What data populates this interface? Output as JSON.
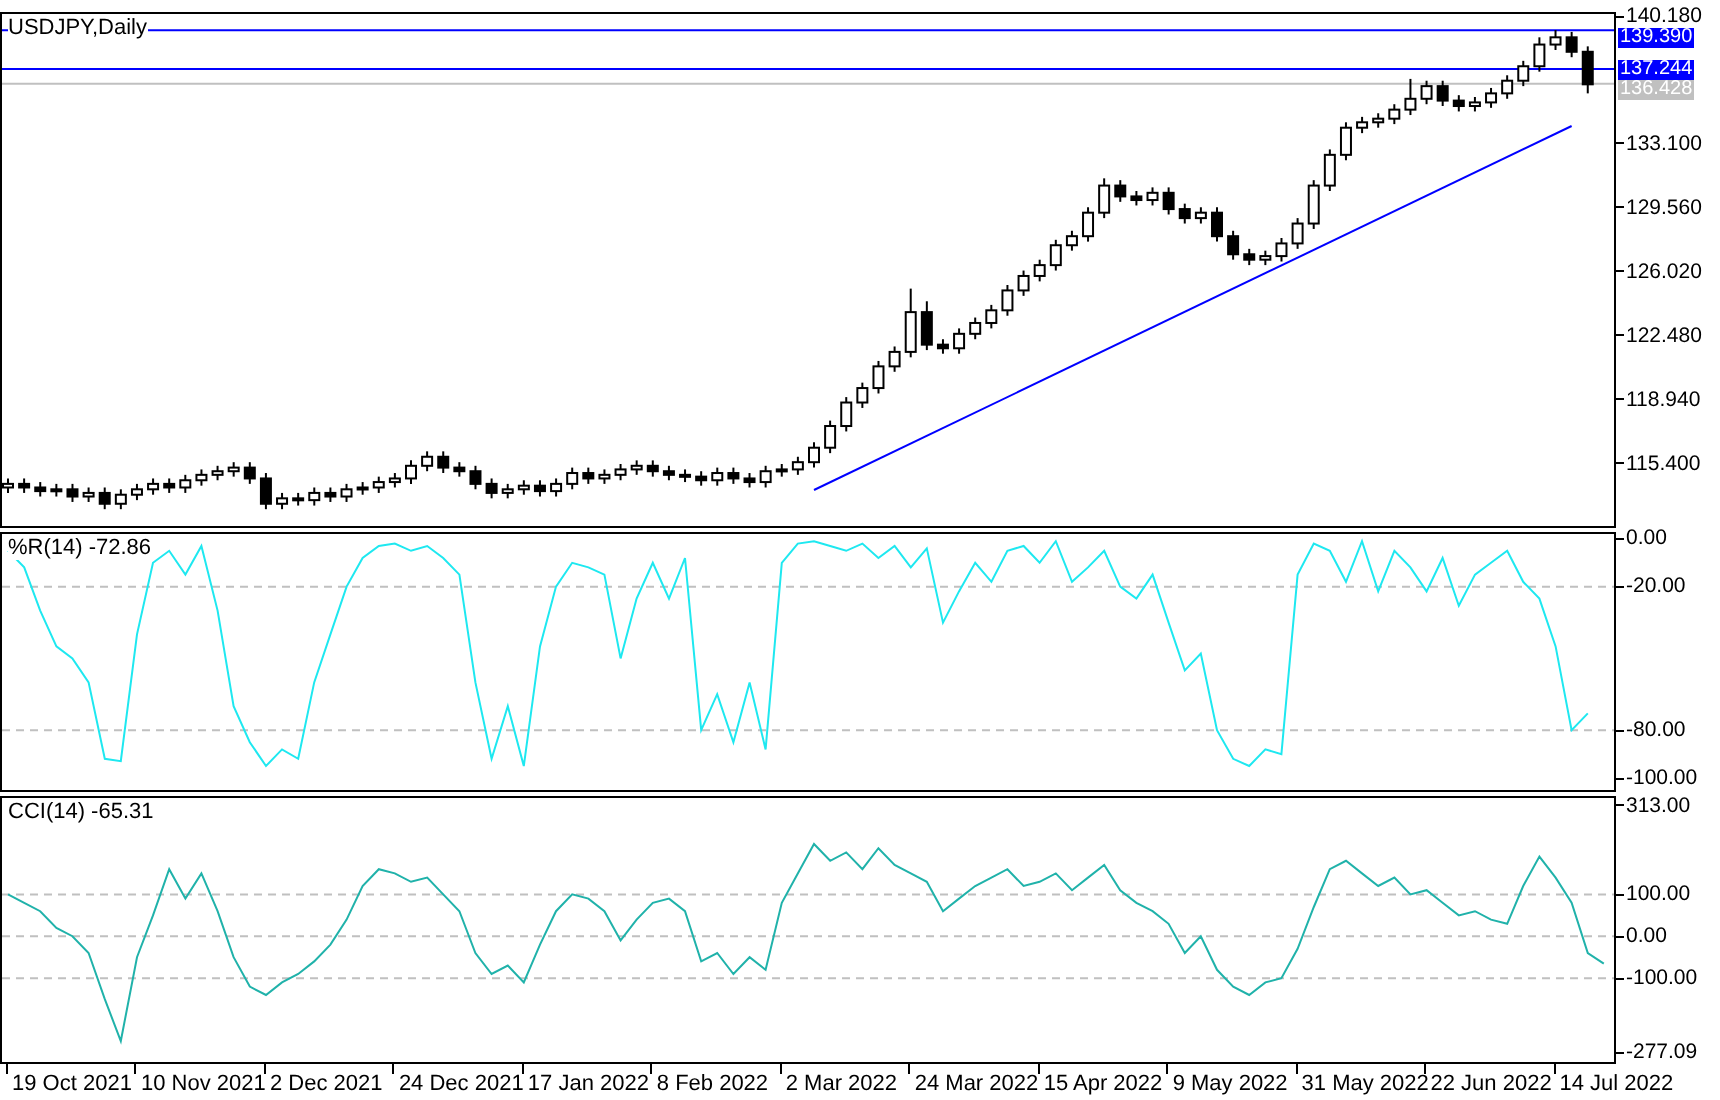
{
  "price_chart": {
    "chart_data": {
      "type": "candlestick",
      "title": "USDJPY,Daily",
      "ylim": [
        111.97,
        140.29
      ],
      "yticks": [
        {
          "value": 140.18,
          "label": "140.180"
        },
        {
          "value": 133.1,
          "label": "133.100"
        },
        {
          "value": 129.56,
          "label": "129.560"
        },
        {
          "value": 126.02,
          "label": "126.020"
        },
        {
          "value": 122.48,
          "label": "122.480"
        },
        {
          "value": 118.94,
          "label": "118.940"
        },
        {
          "value": 115.4,
          "label": "115.400"
        }
      ],
      "ohlc": [
        [
          114.1,
          114.6,
          113.8,
          114.3
        ],
        [
          114.3,
          114.6,
          113.8,
          114.1
        ],
        [
          114.1,
          114.4,
          113.6,
          113.9
        ],
        [
          113.9,
          114.3,
          113.6,
          114.0
        ],
        [
          114.0,
          114.3,
          113.3,
          113.6
        ],
        [
          113.6,
          114.1,
          113.3,
          113.8
        ],
        [
          113.8,
          114.1,
          112.9,
          113.2
        ],
        [
          113.2,
          114.0,
          112.9,
          113.7
        ],
        [
          113.7,
          114.3,
          113.4,
          114.0
        ],
        [
          114.0,
          114.6,
          113.7,
          114.3
        ],
        [
          114.3,
          114.6,
          113.8,
          114.1
        ],
        [
          114.1,
          114.8,
          113.8,
          114.5
        ],
        [
          114.5,
          115.1,
          114.2,
          114.8
        ],
        [
          114.8,
          115.3,
          114.5,
          115.0
        ],
        [
          115.0,
          115.5,
          114.7,
          115.2
        ],
        [
          115.2,
          115.5,
          114.3,
          114.6
        ],
        [
          114.6,
          114.9,
          112.9,
          113.2
        ],
        [
          113.2,
          113.8,
          112.9,
          113.5
        ],
        [
          113.5,
          113.8,
          113.1,
          113.4
        ],
        [
          113.4,
          114.1,
          113.1,
          113.8
        ],
        [
          113.8,
          114.1,
          113.3,
          113.6
        ],
        [
          113.6,
          114.3,
          113.3,
          114.0
        ],
        [
          114.0,
          114.4,
          113.7,
          114.1
        ],
        [
          114.1,
          114.7,
          113.8,
          114.4
        ],
        [
          114.4,
          114.9,
          114.1,
          114.6
        ],
        [
          114.6,
          115.6,
          114.3,
          115.3
        ],
        [
          115.3,
          116.1,
          115.0,
          115.8
        ],
        [
          115.8,
          116.1,
          114.9,
          115.2
        ],
        [
          115.2,
          115.5,
          114.7,
          115.0
        ],
        [
          115.0,
          115.3,
          114.0,
          114.3
        ],
        [
          114.3,
          114.6,
          113.5,
          113.8
        ],
        [
          113.8,
          114.3,
          113.5,
          114.0
        ],
        [
          114.0,
          114.5,
          113.7,
          114.2
        ],
        [
          114.2,
          114.5,
          113.6,
          113.9
        ],
        [
          113.9,
          114.6,
          113.6,
          114.3
        ],
        [
          114.3,
          115.2,
          114.0,
          114.9
        ],
        [
          114.9,
          115.2,
          114.3,
          114.6
        ],
        [
          114.6,
          115.1,
          114.3,
          114.8
        ],
        [
          114.8,
          115.4,
          114.5,
          115.1
        ],
        [
          115.1,
          115.6,
          114.8,
          115.3
        ],
        [
          115.3,
          115.6,
          114.7,
          115.0
        ],
        [
          115.0,
          115.3,
          114.5,
          114.8
        ],
        [
          114.8,
          115.1,
          114.4,
          114.7
        ],
        [
          114.7,
          115.0,
          114.2,
          114.5
        ],
        [
          114.5,
          115.2,
          114.2,
          114.9
        ],
        [
          114.9,
          115.2,
          114.3,
          114.6
        ],
        [
          114.6,
          114.9,
          114.1,
          114.4
        ],
        [
          114.4,
          115.3,
          114.1,
          115.0
        ],
        [
          115.0,
          115.4,
          114.7,
          115.1
        ],
        [
          115.1,
          115.8,
          114.8,
          115.5
        ],
        [
          115.5,
          116.6,
          115.2,
          116.3
        ],
        [
          116.3,
          117.8,
          116.0,
          117.5
        ],
        [
          117.5,
          119.1,
          117.2,
          118.8
        ],
        [
          118.8,
          119.9,
          118.5,
          119.6
        ],
        [
          119.6,
          121.1,
          119.3,
          120.8
        ],
        [
          120.8,
          121.9,
          120.5,
          121.6
        ],
        [
          121.6,
          125.1,
          121.3,
          123.8
        ],
        [
          123.8,
          124.4,
          121.7,
          122.0
        ],
        [
          122.0,
          122.3,
          121.5,
          121.8
        ],
        [
          121.8,
          122.9,
          121.5,
          122.6
        ],
        [
          122.6,
          123.5,
          122.3,
          123.2
        ],
        [
          123.2,
          124.2,
          122.9,
          123.9
        ],
        [
          123.9,
          125.3,
          123.6,
          125.0
        ],
        [
          125.0,
          126.1,
          124.7,
          125.8
        ],
        [
          125.8,
          126.7,
          125.5,
          126.4
        ],
        [
          126.4,
          127.8,
          126.1,
          127.5
        ],
        [
          127.5,
          128.3,
          127.2,
          128.0
        ],
        [
          128.0,
          129.6,
          127.7,
          129.3
        ],
        [
          129.3,
          131.2,
          129.0,
          130.8
        ],
        [
          130.8,
          131.1,
          129.9,
          130.2
        ],
        [
          130.2,
          130.5,
          129.7,
          130.0
        ],
        [
          130.0,
          130.7,
          129.7,
          130.4
        ],
        [
          130.4,
          130.7,
          129.2,
          129.5
        ],
        [
          129.5,
          129.8,
          128.7,
          129.0
        ],
        [
          129.0,
          129.6,
          128.7,
          129.3
        ],
        [
          129.3,
          129.6,
          127.7,
          128.0
        ],
        [
          128.0,
          128.3,
          126.7,
          127.0
        ],
        [
          127.0,
          127.3,
          126.4,
          126.7
        ],
        [
          126.7,
          127.2,
          126.4,
          126.9
        ],
        [
          126.9,
          127.9,
          126.6,
          127.6
        ],
        [
          127.6,
          129.0,
          127.3,
          128.7
        ],
        [
          128.7,
          131.1,
          128.4,
          130.8
        ],
        [
          130.8,
          132.8,
          130.5,
          132.5
        ],
        [
          132.5,
          134.3,
          132.2,
          134.0
        ],
        [
          134.0,
          134.6,
          133.7,
          134.3
        ],
        [
          134.3,
          134.8,
          134.0,
          134.5
        ],
        [
          134.5,
          135.3,
          134.2,
          135.0
        ],
        [
          135.0,
          136.7,
          134.7,
          135.6
        ],
        [
          135.6,
          136.6,
          135.3,
          136.3
        ],
        [
          136.3,
          136.6,
          135.2,
          135.5
        ],
        [
          135.5,
          135.8,
          134.9,
          135.2
        ],
        [
          135.2,
          135.7,
          134.9,
          135.4
        ],
        [
          135.4,
          136.2,
          135.1,
          135.9
        ],
        [
          135.9,
          136.9,
          135.6,
          136.6
        ],
        [
          136.6,
          137.7,
          136.3,
          137.4
        ],
        [
          137.4,
          139.0,
          137.1,
          138.6
        ],
        [
          138.6,
          139.4,
          138.3,
          139.0
        ],
        [
          139.0,
          139.3,
          137.9,
          138.2
        ],
        [
          138.2,
          138.5,
          135.9,
          136.4
        ]
      ],
      "ref_lines": [
        {
          "axis": "y",
          "value": 139.39,
          "label": "139.390",
          "color": "#0000ff"
        },
        {
          "axis": "y",
          "value": 137.244,
          "label": "137.244",
          "color": "#0000ff"
        },
        {
          "axis": "y",
          "value": 136.428,
          "label": "136.428",
          "color": "#c0c0c0"
        }
      ]
    }
  },
  "indicators": [
    {
      "chart_data": {
        "type": "line",
        "title": "%R(14) -72.86",
        "ylim": [
          -105,
          2
        ],
        "grid": true,
        "yticks": [
          {
            "value": 0,
            "label": "0.00"
          },
          {
            "value": -20,
            "label": "-20.00"
          },
          {
            "value": -80,
            "label": "-80.00"
          },
          {
            "value": -100,
            "label": "-100.00"
          }
        ],
        "series": [
          {
            "color": "#1ee8f0",
            "values": [
              -5,
              -12,
              -30,
              -45,
              -50,
              -60,
              -92,
              -93,
              -40,
              -10,
              -5,
              -15,
              -3,
              -30,
              -70,
              -85,
              -95,
              -88,
              -92,
              -60,
              -40,
              -20,
              -8,
              -3,
              -2,
              -5,
              -3,
              -8,
              -15,
              -60,
              -92,
              -70,
              -95,
              -45,
              -20,
              -10,
              -12,
              -15,
              -50,
              -25,
              -10,
              -25,
              -8,
              -80,
              -65,
              -85,
              -60,
              -88,
              -10,
              -2,
              -1,
              -3,
              -5,
              -2,
              -8,
              -3,
              -12,
              -4,
              -35,
              -22,
              -10,
              -18,
              -5,
              -3,
              -10,
              -1,
              -18,
              -12,
              -5,
              -20,
              -25,
              -15,
              -35,
              -55,
              -48,
              -80,
              -92,
              -95,
              -88,
              -90,
              -15,
              -2,
              -5,
              -18,
              -1,
              -22,
              -5,
              -12,
              -22,
              -8,
              -28,
              -15,
              -10,
              -5,
              -18,
              -25,
              -45,
              -80,
              -73
            ]
          }
        ]
      }
    },
    {
      "chart_data": {
        "type": "line",
        "title": "CCI(14) -65.31",
        "ylim": [
          -300,
          330
        ],
        "grid": true,
        "yticks": [
          {
            "value": 313,
            "label": "313.00"
          },
          {
            "value": 100,
            "label": "100.00"
          },
          {
            "value": 0,
            "label": "0.00"
          },
          {
            "value": -100,
            "label": "-100.00"
          },
          {
            "value": -277.09,
            "label": "-277.09"
          }
        ],
        "series": [
          {
            "color": "#20b2aa",
            "values": [
              100,
              80,
              60,
              20,
              0,
              -40,
              -150,
              -250,
              -50,
              50,
              160,
              90,
              150,
              60,
              -50,
              -120,
              -140,
              -110,
              -90,
              -60,
              -20,
              40,
              120,
              160,
              150,
              130,
              140,
              100,
              60,
              -40,
              -90,
              -70,
              -110,
              -20,
              60,
              100,
              90,
              60,
              -10,
              40,
              80,
              90,
              60,
              -60,
              -40,
              -90,
              -50,
              -80,
              80,
              150,
              220,
              180,
              200,
              160,
              210,
              170,
              150,
              130,
              60,
              90,
              120,
              140,
              160,
              120,
              130,
              150,
              110,
              140,
              170,
              110,
              80,
              60,
              30,
              -40,
              0,
              -80,
              -120,
              -140,
              -110,
              -100,
              -30,
              70,
              160,
              180,
              150,
              120,
              140,
              100,
              110,
              80,
              50,
              60,
              40,
              30,
              120,
              190,
              140,
              80,
              -40,
              -65
            ]
          }
        ]
      }
    }
  ],
  "time_axis": {
    "labels": [
      "19 Oct 2021",
      "10 Nov 2021",
      "2 Dec 2021",
      "24 Dec 2021",
      "17 Jan 2022",
      "8 Feb 2022",
      "2 Mar 2022",
      "24 Mar 2022",
      "15 Apr 2022",
      "9 May 2022",
      "31 May 2022",
      "22 Jun 2022",
      "14 Jul 2022"
    ]
  }
}
